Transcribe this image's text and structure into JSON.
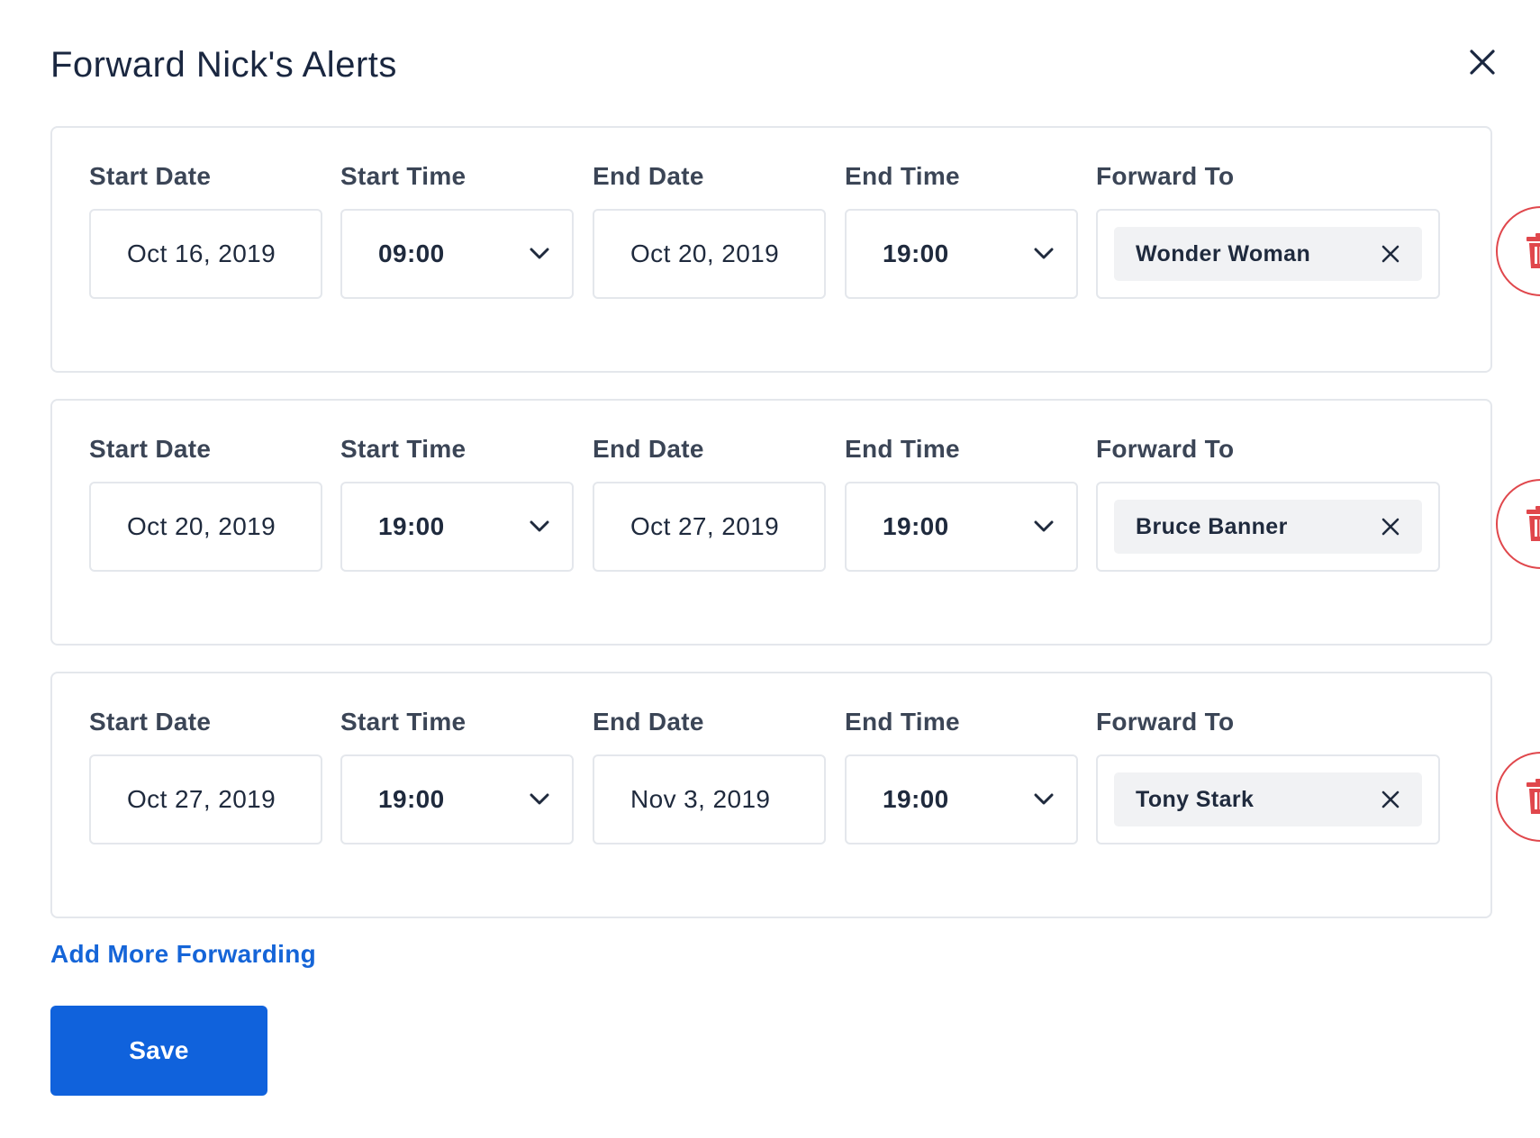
{
  "modal": {
    "title": "Forward Nick's Alerts"
  },
  "labels": {
    "start_date": "Start Date",
    "start_time": "Start Time",
    "end_date": "End Date",
    "end_time": "End Time",
    "forward_to": "Forward To"
  },
  "rules": [
    {
      "start_date": "Oct 16, 2019",
      "start_time": "09:00",
      "end_date": "Oct 20, 2019",
      "end_time": "19:00",
      "forward_to": "Wonder Woman"
    },
    {
      "start_date": "Oct 20, 2019",
      "start_time": "19:00",
      "end_date": "Oct 27, 2019",
      "end_time": "19:00",
      "forward_to": "Bruce Banner"
    },
    {
      "start_date": "Oct 27, 2019",
      "start_time": "19:00",
      "end_date": "Nov 3, 2019",
      "end_time": "19:00",
      "forward_to": "Tony Stark"
    }
  ],
  "actions": {
    "add_more": "Add More Forwarding",
    "save": "Save"
  },
  "colors": {
    "primary": "#1062dc",
    "link": "#1565d8",
    "danger": "#e0474c",
    "border": "#e4e7ec",
    "chip_bg": "#f1f2f4"
  },
  "icons": {
    "close": "close-icon",
    "chevron": "chevron-down-icon",
    "chip_remove": "close-icon",
    "delete": "trash-icon"
  }
}
